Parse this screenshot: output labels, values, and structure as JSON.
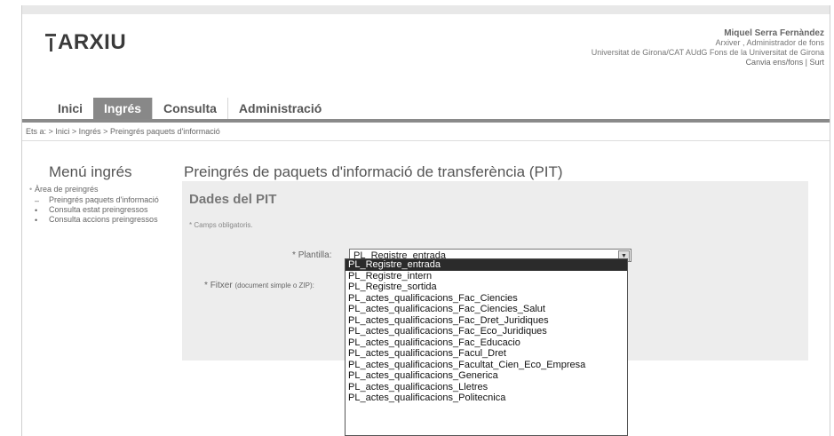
{
  "header": {
    "logo_text": "ARXIU",
    "user_name": "Miquel Serra Fernàndez",
    "user_role": "Arxiver , Administrador de fons",
    "institution": "Universitat de Girona/CAT AUdG Fons de la Universitat de Girona",
    "link_change_fons": "Canvia ens/fons",
    "separator": "|",
    "link_logout": "Surt"
  },
  "tabs": [
    {
      "label": "Inici",
      "active": false
    },
    {
      "label": "Ingrés",
      "active": true
    },
    {
      "label": "Consulta",
      "active": false
    },
    {
      "label": "Administració",
      "active": false
    }
  ],
  "breadcrumb": {
    "prefix": "Ets a:",
    "items": [
      "Inici",
      "Ingrés",
      "Preingrés paquets d'informació"
    ],
    "separator": ">"
  },
  "sidebar": {
    "title": "Menú ingrés",
    "section": "Àrea de preingrés",
    "items": [
      "Preingrés paquets d'informació",
      "Consulta estat preingressos",
      "Consulta accions preingressos"
    ]
  },
  "main": {
    "title": "Preingrés de paquets d'informació de transferència (PIT)",
    "panel_title": "Dades del PIT",
    "required_note": "Camps obligatoris.",
    "plantilla_label": "Plantilla:",
    "fitxer_label": "Fitxer",
    "fitxer_hint": "(document simple o ZIP):",
    "plantilla_value": "PL_Registre_entrada",
    "asterisk": "*"
  },
  "dropdown_options": [
    "PL_Registre_entrada",
    "PL_Registre_intern",
    "PL_Registre_sortida",
    "PL_actes_qualificacions_Fac_Ciencies",
    "PL_actes_qualificacions_Fac_Ciencies_Salut",
    "PL_actes_qualificacions_Fac_Dret_Juridiques",
    "PL_actes_qualificacions_Fac_Eco_Juridiques",
    "PL_actes_qualificacions_Fac_Educacio",
    "PL_actes_qualificacions_Facul_Dret",
    "PL_actes_qualificacions_Facultat_Cien_Eco_Empresa",
    "PL_actes_qualificacions_Generica",
    "PL_actes_qualificacions_Lletres",
    "PL_actes_qualificacions_Politecnica"
  ],
  "selected_option_index": 0,
  "icons": {
    "dropdown_arrow": "chevron-down-icon"
  }
}
